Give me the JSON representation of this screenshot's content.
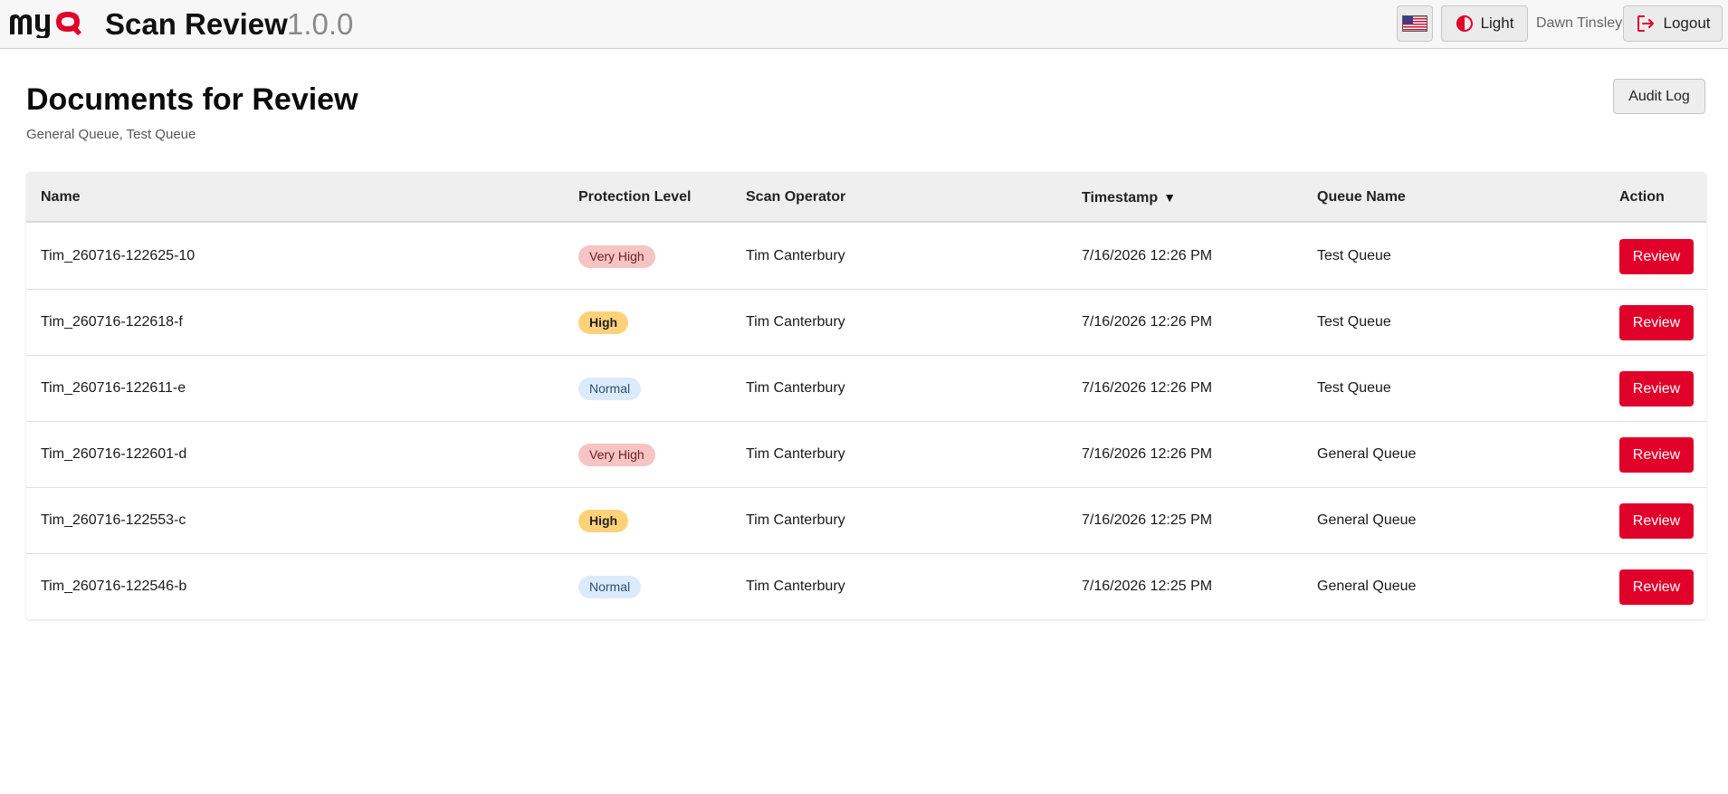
{
  "app": {
    "logo_text": "myQ",
    "title": "Scan Review",
    "version": "1.0.0",
    "theme_label": "Light",
    "user_name": "Dawn Tinsley",
    "logout_label": "Logout",
    "accent_color": "#e0002a"
  },
  "page": {
    "title": "Documents for Review",
    "subtitle": "General Queue, Test Queue",
    "audit_log_label": "Audit Log"
  },
  "table": {
    "headers": {
      "name": "Name",
      "protection": "Protection Level",
      "operator": "Scan Operator",
      "timestamp": "Timestamp",
      "timestamp_sort": "▼",
      "queue": "Queue Name",
      "action": "Action"
    },
    "rows": [
      {
        "name": "Tim_260716-122625-10",
        "protection": "Very High",
        "operator": "Tim Canterbury",
        "timestamp": "7/16/2026 12:26 PM",
        "queue": "Test Queue",
        "action": "Review"
      },
      {
        "name": "Tim_260716-122618-f",
        "protection": "High",
        "operator": "Tim Canterbury",
        "timestamp": "7/16/2026 12:26 PM",
        "queue": "Test Queue",
        "action": "Review"
      },
      {
        "name": "Tim_260716-122611-e",
        "protection": "Normal",
        "operator": "Tim Canterbury",
        "timestamp": "7/16/2026 12:26 PM",
        "queue": "Test Queue",
        "action": "Review"
      },
      {
        "name": "Tim_260716-122601-d",
        "protection": "Very High",
        "operator": "Tim Canterbury",
        "timestamp": "7/16/2026 12:26 PM",
        "queue": "General Queue",
        "action": "Review"
      },
      {
        "name": "Tim_260716-122553-c",
        "protection": "High",
        "operator": "Tim Canterbury",
        "timestamp": "7/16/2026 12:25 PM",
        "queue": "General Queue",
        "action": "Review"
      },
      {
        "name": "Tim_260716-122546-b",
        "protection": "Normal",
        "operator": "Tim Canterbury",
        "timestamp": "7/16/2026 12:25 PM",
        "queue": "General Queue",
        "action": "Review"
      }
    ]
  }
}
